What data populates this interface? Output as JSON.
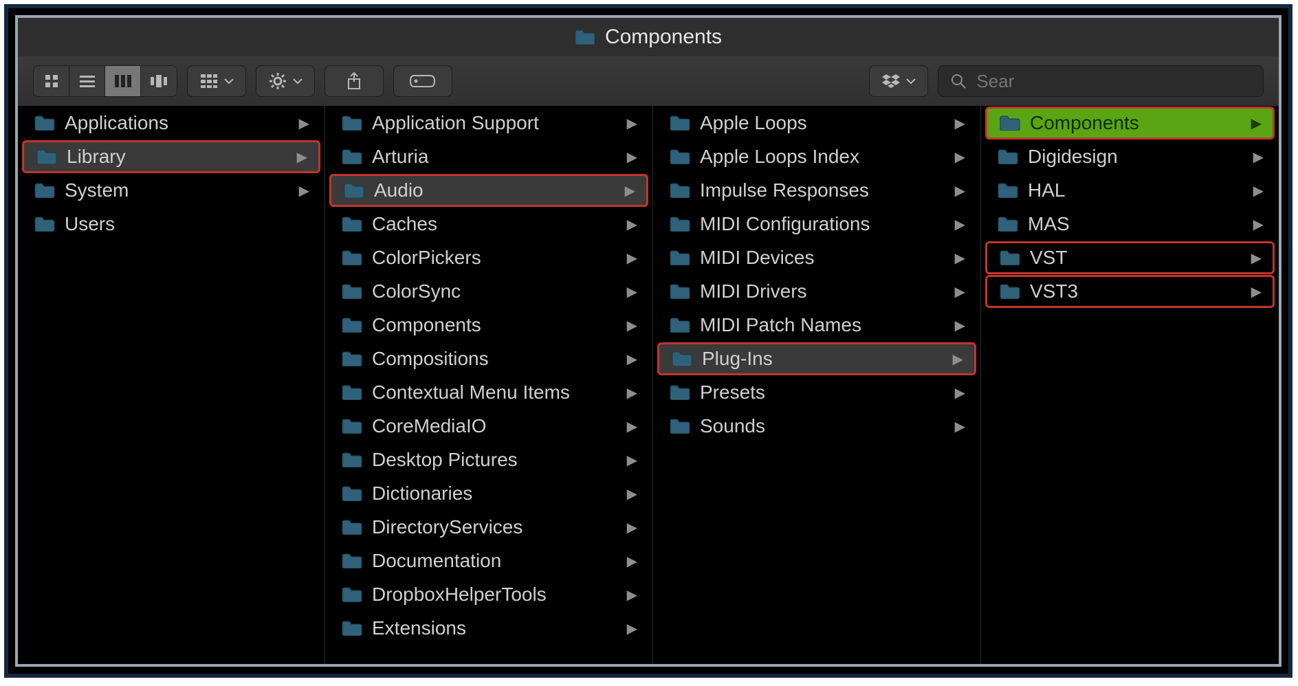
{
  "window_title": "Components",
  "search": {
    "placeholder": "Sear"
  },
  "toolbar_icons": {
    "view_icon": "icon-view-icon",
    "view_list": "list-view-icon",
    "view_column": "column-view-icon",
    "view_cover": "coverflow-view-icon",
    "group": "group-icon",
    "action": "gear-icon",
    "share": "share-icon",
    "tags": "tag-icon",
    "dropbox": "dropbox-icon",
    "search": "search-icon"
  },
  "columns": [
    {
      "width_class": "c0",
      "items": [
        {
          "name": "Applications",
          "has_children": true,
          "selected": false,
          "highlight": false
        },
        {
          "name": "Library",
          "has_children": true,
          "selected": true,
          "highlight": true
        },
        {
          "name": "System",
          "has_children": true,
          "selected": false,
          "highlight": false
        },
        {
          "name": "Users",
          "has_children": true,
          "selected": false,
          "highlight": false,
          "hide_chevron": true
        }
      ]
    },
    {
      "width_class": "c1",
      "items": [
        {
          "name": "Application Support",
          "has_children": true,
          "selected": false,
          "highlight": false
        },
        {
          "name": "Arturia",
          "has_children": true,
          "selected": false,
          "highlight": false
        },
        {
          "name": "Audio",
          "has_children": true,
          "selected": true,
          "highlight": true
        },
        {
          "name": "Caches",
          "has_children": true,
          "selected": false,
          "highlight": false
        },
        {
          "name": "ColorPickers",
          "has_children": true,
          "selected": false,
          "highlight": false
        },
        {
          "name": "ColorSync",
          "has_children": true,
          "selected": false,
          "highlight": false
        },
        {
          "name": "Components",
          "has_children": true,
          "selected": false,
          "highlight": false
        },
        {
          "name": "Compositions",
          "has_children": true,
          "selected": false,
          "highlight": false
        },
        {
          "name": "Contextual Menu Items",
          "has_children": true,
          "selected": false,
          "highlight": false
        },
        {
          "name": "CoreMediaIO",
          "has_children": true,
          "selected": false,
          "highlight": false
        },
        {
          "name": "Desktop Pictures",
          "has_children": true,
          "selected": false,
          "highlight": false
        },
        {
          "name": "Dictionaries",
          "has_children": true,
          "selected": false,
          "highlight": false
        },
        {
          "name": "DirectoryServices",
          "has_children": true,
          "selected": false,
          "highlight": false
        },
        {
          "name": "Documentation",
          "has_children": true,
          "selected": false,
          "highlight": false
        },
        {
          "name": "DropboxHelperTools",
          "has_children": true,
          "selected": false,
          "highlight": false
        },
        {
          "name": "Extensions",
          "has_children": true,
          "selected": false,
          "highlight": false
        }
      ]
    },
    {
      "width_class": "c2",
      "items": [
        {
          "name": "Apple Loops",
          "has_children": true,
          "selected": false,
          "highlight": false
        },
        {
          "name": "Apple Loops Index",
          "has_children": true,
          "selected": false,
          "highlight": false
        },
        {
          "name": "Impulse Responses",
          "has_children": true,
          "selected": false,
          "highlight": false
        },
        {
          "name": "MIDI Configurations",
          "has_children": true,
          "selected": false,
          "highlight": false
        },
        {
          "name": "MIDI Devices",
          "has_children": true,
          "selected": false,
          "highlight": false
        },
        {
          "name": "MIDI Drivers",
          "has_children": true,
          "selected": false,
          "highlight": false
        },
        {
          "name": "MIDI Patch Names",
          "has_children": true,
          "selected": false,
          "highlight": false
        },
        {
          "name": "Plug-Ins",
          "has_children": true,
          "selected": true,
          "highlight": true
        },
        {
          "name": "Presets",
          "has_children": true,
          "selected": false,
          "highlight": false
        },
        {
          "name": "Sounds",
          "has_children": true,
          "selected": false,
          "highlight": false
        }
      ]
    },
    {
      "width_class": "c3",
      "items": [
        {
          "name": "Components",
          "has_children": true,
          "selected": false,
          "highlight": true,
          "green": true
        },
        {
          "name": "Digidesign",
          "has_children": true,
          "selected": false,
          "highlight": false
        },
        {
          "name": "HAL",
          "has_children": true,
          "selected": false,
          "highlight": false
        },
        {
          "name": "MAS",
          "has_children": true,
          "selected": false,
          "highlight": false
        },
        {
          "name": "VST",
          "has_children": true,
          "selected": false,
          "highlight": true
        },
        {
          "name": "VST3",
          "has_children": true,
          "selected": false,
          "highlight": true
        }
      ]
    }
  ]
}
